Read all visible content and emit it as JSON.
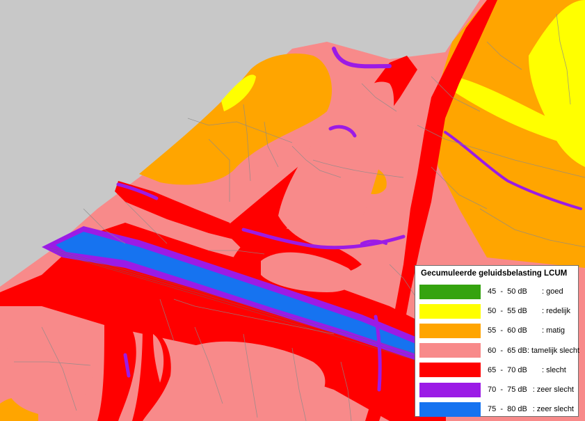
{
  "legend": {
    "title": "Gecumuleerde geluidsbelasting LCUM",
    "items": [
      {
        "range": "45  -  50 dB",
        "rating": ":  goed",
        "color": "#35a30f"
      },
      {
        "range": "50  -  55 dB",
        "rating": ":  redelijk",
        "color": "#ffff00"
      },
      {
        "range": "55  -  60 dB",
        "rating": ":  matig",
        "color": "#ffa500"
      },
      {
        "range": "60  -  65 dB",
        "rating": ":  tamelijk slecht",
        "color": "#f88a8a"
      },
      {
        "range": "65  -  70 dB",
        "rating": ":  slecht",
        "color": "#ff0000"
      },
      {
        "range": "70  -  75 dB",
        "rating": ":  zeer slecht",
        "color": "#9b1be6"
      },
      {
        "range": "75  -  80 dB",
        "rating": ":  zeer slecht",
        "color": "#1673f0"
      }
    ]
  },
  "colors": {
    "background_outside": "#c8c8c8",
    "road_lines": "#8a8a8a"
  }
}
